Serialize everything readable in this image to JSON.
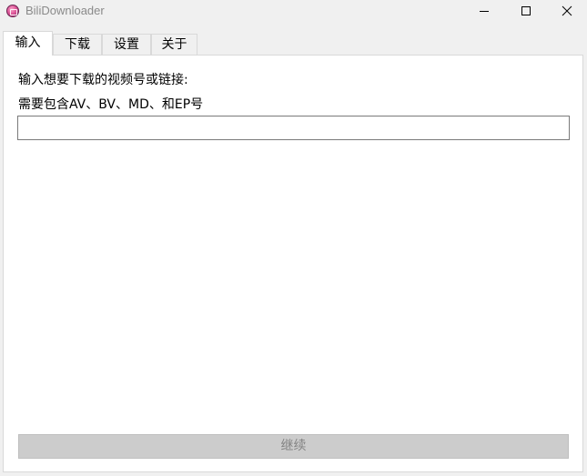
{
  "window": {
    "title": "BiliDownloader",
    "icon": "bilidownloader-app-icon",
    "controls": {
      "minimize_icon": "minimize-icon",
      "maximize_icon": "maximize-icon",
      "close_icon": "close-icon"
    }
  },
  "tabs": [
    {
      "label": "输入",
      "active": true
    },
    {
      "label": "下载",
      "active": false
    },
    {
      "label": "设置",
      "active": false
    },
    {
      "label": "关于",
      "active": false
    }
  ],
  "main": {
    "prompt_line1": "输入想要下载的视频号或链接:",
    "prompt_line2": "需要包含AV、BV、MD、和EP号",
    "input_value": "",
    "input_placeholder": "",
    "continue_label": "继续"
  },
  "colors": {
    "background": "#f0f0f0",
    "panel": "#ffffff",
    "disabled_button": "#cccccc",
    "disabled_text": "#838383"
  }
}
